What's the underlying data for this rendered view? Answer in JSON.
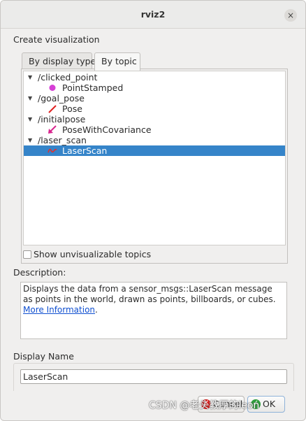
{
  "window": {
    "title": "rviz2",
    "close_icon": "×"
  },
  "create_label": "Create visualization",
  "tabs": [
    {
      "label": "By display type",
      "active": false
    },
    {
      "label": "By topic",
      "active": true
    }
  ],
  "tree": {
    "expand_glyph": "▼",
    "topics": [
      {
        "topic": "/clicked_point",
        "child": "PointStamped",
        "icon": "point-dot-icon"
      },
      {
        "topic": "/goal_pose",
        "child": "Pose",
        "icon": "pose-arrow-icon"
      },
      {
        "topic": "/initialpose",
        "child": "PoseWithCovariance",
        "icon": "pose-covariance-icon"
      },
      {
        "topic": "/laser_scan",
        "child": "LaserScan",
        "icon": "laser-scan-icon",
        "selected": true
      }
    ]
  },
  "show_unvisualizable": {
    "label": "Show unvisualizable topics",
    "checked": false
  },
  "description": {
    "label": "Description:",
    "text": "Displays the data from a sensor_msgs::LaserScan message as points in the world, drawn as points, billboards, or cubes. ",
    "link": "More Information",
    "trailing": "."
  },
  "display_name": {
    "label": "Display Name",
    "value": "LaserScan"
  },
  "buttons": {
    "cancel": "Cancel",
    "ok": "OK"
  },
  "watermark": "CSDN @老头教厚的leon",
  "colors": {
    "selection": "#3584c9",
    "point": "#d63fd6",
    "pose": "#e02020",
    "pose_covariance": "#d9258f",
    "laser": "#e03030"
  }
}
